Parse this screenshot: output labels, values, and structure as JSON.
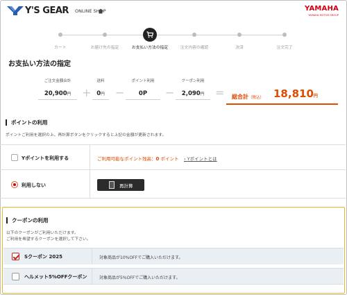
{
  "header": {
    "logo_text": "Y'S GEAR",
    "shop_label": "ONLINE SHOP",
    "brand": "YAMAHA",
    "brand_sub": "YAMAHA MOTOR GROUP"
  },
  "steps": [
    {
      "label": "カート",
      "active": false
    },
    {
      "label": "お届け先の指定",
      "active": false
    },
    {
      "label": "お支払い方法の指定",
      "active": true
    },
    {
      "label": "注文内容の確認",
      "active": false
    },
    {
      "label": "決済",
      "active": false
    },
    {
      "label": "注文完了",
      "active": false
    }
  ],
  "page_title": "お支払い方法の指定",
  "summary": {
    "subtotal_label": "ご注文金額合計",
    "subtotal_value": "20,900",
    "shipping_label": "送料",
    "shipping_value": "0",
    "points_label": "ポイント利用",
    "points_value": "0P",
    "coupon_label": "クーポン利用",
    "coupon_value": "2,090",
    "yen": "円",
    "total_label": "総合計",
    "total_tax": "（税込）",
    "total_value": "18,810",
    "op_plus": "+",
    "op_minus": "−",
    "op_eq": "="
  },
  "points_section": {
    "heading": "ポイントの利用",
    "note": "ポイントご利用を選択の上、再計算ボタンをクリックすると上記の金額が更新されます。",
    "use_label": "Yポイントを利用する",
    "available_prefix": "ご利用可能なポイント残高：",
    "available_value": "0",
    "available_suffix": " ポイント",
    "about_link": "Yポイントとは",
    "no_use_label": "利用しない",
    "recalc_label": "再計算"
  },
  "coupon_section": {
    "heading": "クーポンの利用",
    "note_1": "以下のクーポンがご利用いただけます。",
    "note_2": "ご利用を希望するクーポンを選択して下さい。",
    "items": [
      {
        "name": "Sクーポン 2025",
        "desc": "対象商品が10%OFFでご購入いただけます。",
        "checked": true
      },
      {
        "name": "ヘルメット5%OFFクーポン",
        "desc": "対象商品が5%OFFでご購入いただけます。",
        "checked": false
      }
    ]
  },
  "colors": {
    "accent": "#e24a00",
    "brand": "#d3000f",
    "coupon_border": "#e8b820"
  }
}
